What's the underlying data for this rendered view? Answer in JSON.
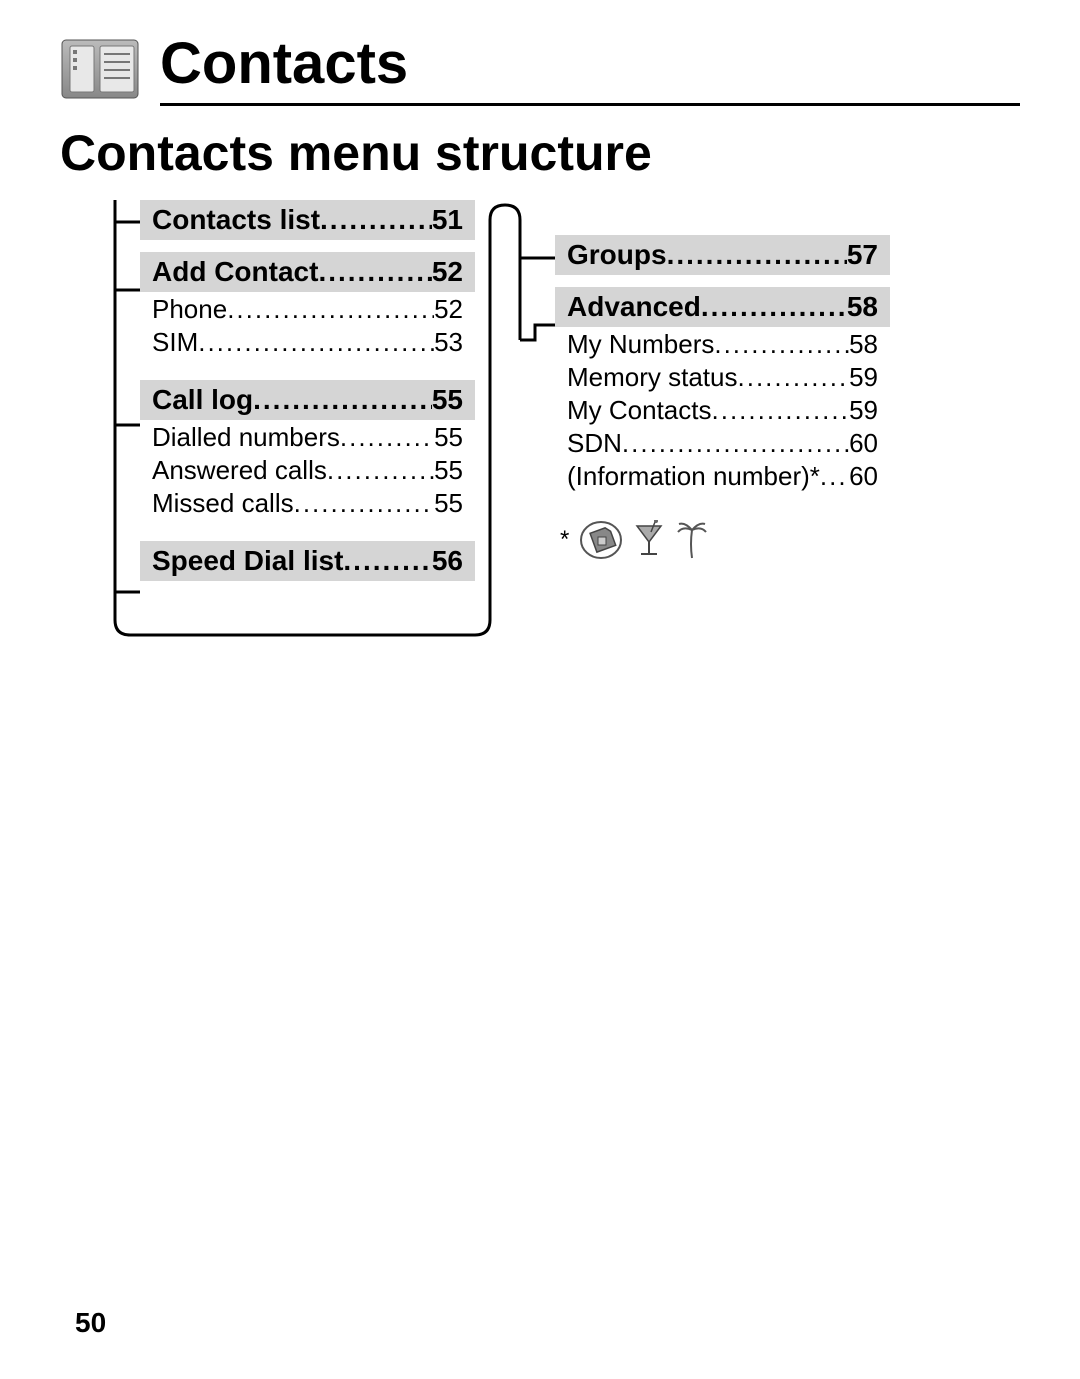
{
  "header": {
    "title": "Contacts"
  },
  "section_title": "Contacts menu structure",
  "left": [
    {
      "heading": {
        "label": "Contacts list",
        "page": "51"
      },
      "subs": []
    },
    {
      "heading": {
        "label": "Add Contact",
        "page": "52"
      },
      "subs": [
        {
          "label": "Phone",
          "page": "52"
        },
        {
          "label": "SIM",
          "page": "53"
        }
      ]
    },
    {
      "heading": {
        "label": "Call log",
        "page": "55"
      },
      "subs": [
        {
          "label": "Dialled numbers",
          "page": "55"
        },
        {
          "label": "Answered calls",
          "page": "55"
        },
        {
          "label": "Missed calls",
          "page": "55"
        }
      ]
    },
    {
      "heading": {
        "label": "Speed Dial list",
        "page": "56"
      },
      "subs": []
    }
  ],
  "right": [
    {
      "heading": {
        "label": "Groups",
        "page": "57"
      },
      "subs": []
    },
    {
      "heading": {
        "label": "Advanced",
        "page": "58"
      },
      "subs": [
        {
          "label": "My Numbers",
          "page": "58"
        },
        {
          "label": "Memory status",
          "page": "59"
        },
        {
          "label": "My Contacts",
          "page": "59"
        },
        {
          "label": "SDN",
          "page": "60"
        },
        {
          "label": "(Information number)*",
          "page": "60"
        }
      ]
    }
  ],
  "footnote_marker": "*",
  "footer_page": "50"
}
